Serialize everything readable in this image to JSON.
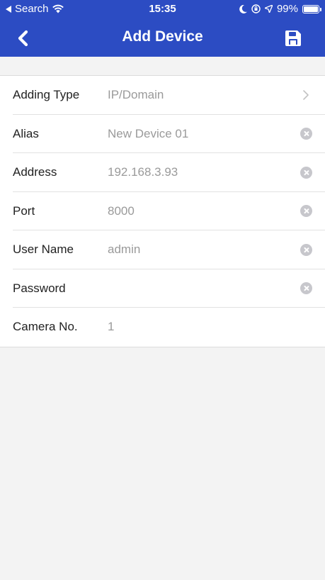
{
  "status_bar": {
    "back_app": "Search",
    "time": "15:35",
    "battery": "99%"
  },
  "nav": {
    "title": "Add Device",
    "back_icon": "chevron-left-icon",
    "save_icon": "floppy-disk-icon"
  },
  "form": {
    "rows": [
      {
        "label": "Adding Type",
        "value": "IP/Domain",
        "accessory": "chevron-right-icon"
      },
      {
        "label": "Alias",
        "value": "New Device 01",
        "accessory": "clear-icon"
      },
      {
        "label": "Address",
        "value": "192.168.3.93",
        "accessory": "clear-icon"
      },
      {
        "label": "Port",
        "value": "8000",
        "accessory": "clear-icon"
      },
      {
        "label": "User Name",
        "value": "admin",
        "accessory": "clear-icon"
      },
      {
        "label": "Password",
        "value": "",
        "accessory": "clear-icon"
      },
      {
        "label": "Camera No.",
        "value": "1",
        "accessory": ""
      }
    ]
  },
  "colors": {
    "header_bg": "#2c4cc3",
    "page_bg": "#f3f3f3",
    "label": "#222222",
    "value": "#9a9a9a"
  }
}
